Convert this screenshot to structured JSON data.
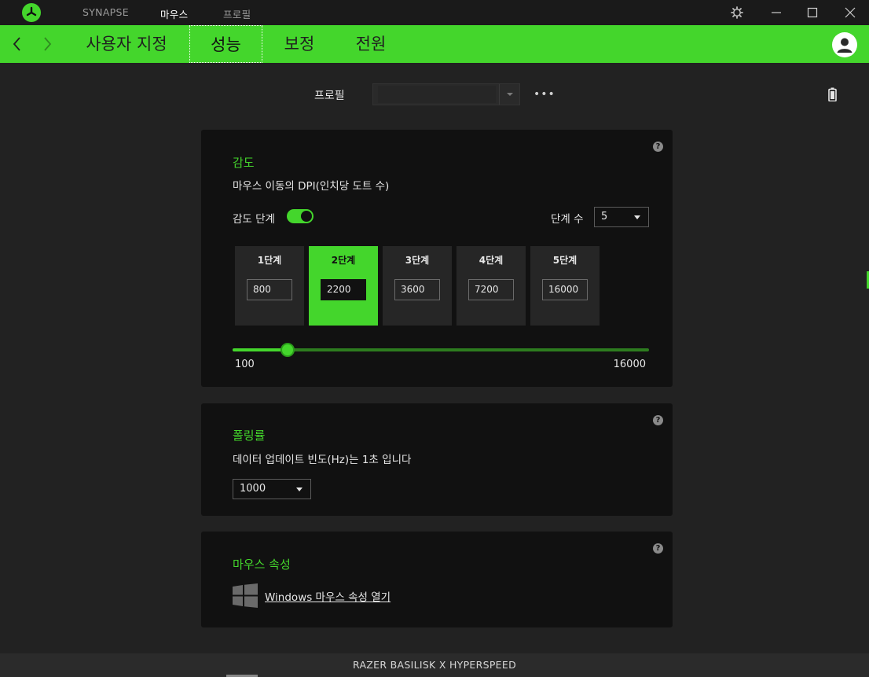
{
  "titlebar": {
    "tabs": [
      {
        "label": "SYNAPSE",
        "active": false
      },
      {
        "label": "마우스",
        "active": true
      },
      {
        "label": "프로필",
        "active": false
      }
    ],
    "icons": [
      "razer-logo-icon",
      "settings-gear-icon",
      "minimize-icon",
      "maximize-icon",
      "close-icon"
    ]
  },
  "nav": {
    "tabs": [
      {
        "label": "사용자 지정",
        "active": false
      },
      {
        "label": "성능",
        "active": true
      },
      {
        "label": "보정",
        "active": false
      },
      {
        "label": "전원",
        "active": false
      }
    ],
    "accent": "#44d62c"
  },
  "profile": {
    "label": "프로필",
    "value": "",
    "more_label": "•••"
  },
  "sensitivity": {
    "title": "감도",
    "description": "마우스 이동의 DPI(인치당 도트 수)",
    "toggle_label": "감도 단계",
    "toggle_on": true,
    "steps_count_label": "단계 수",
    "steps_count_value": "5",
    "stages": [
      {
        "name": "1단계",
        "value": "800",
        "active": false
      },
      {
        "name": "2단계",
        "value": "2200",
        "active": true
      },
      {
        "name": "3단계",
        "value": "3600",
        "active": false
      },
      {
        "name": "4단계",
        "value": "7200",
        "active": false
      },
      {
        "name": "5단계",
        "value": "16000",
        "active": false
      }
    ],
    "slider": {
      "min_label": "100",
      "max_label": "16000",
      "min": 100,
      "max": 16000,
      "value": 2200
    }
  },
  "polling": {
    "title": "폴링률",
    "description": "데이터 업데이트 빈도(Hz)는 1초 입니다",
    "value": "1000"
  },
  "mouse_props": {
    "title": "마우스 속성",
    "link_label": "Windows 마우스 속성 열기"
  },
  "help_label": "?",
  "footer": {
    "device_name": "RAZER BASILISK X HYPERSPEED"
  }
}
